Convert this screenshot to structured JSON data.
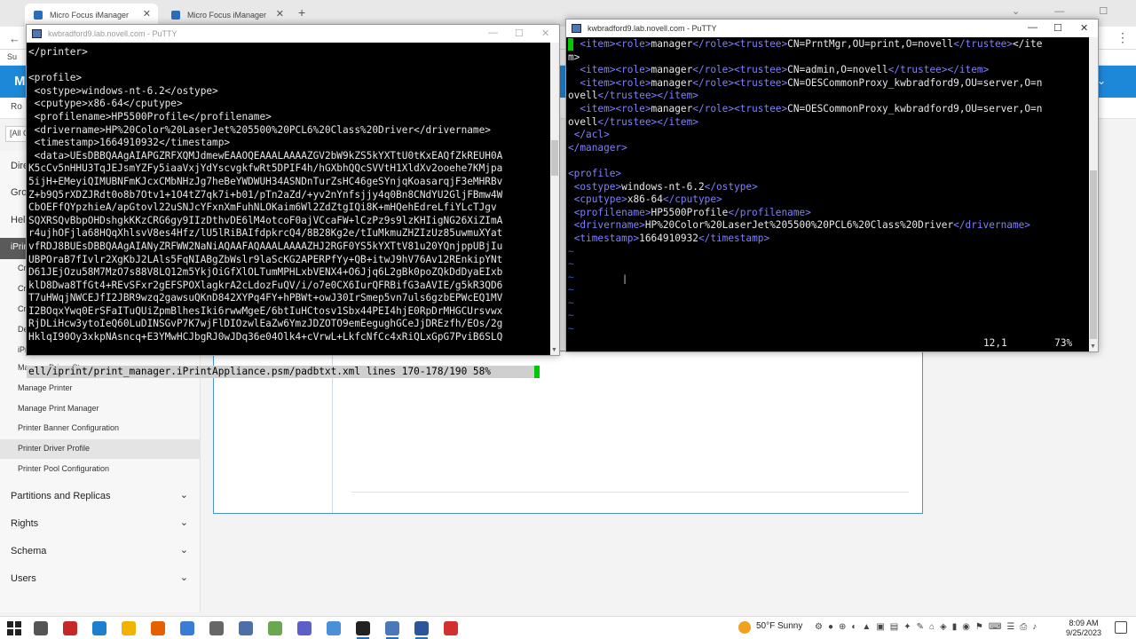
{
  "browser": {
    "tabs": [
      {
        "label": "Micro Focus iManager"
      },
      {
        "label": "Micro Focus iManager"
      }
    ],
    "new_tab_glyph": "+",
    "close_glyph": "✕",
    "back_glyph": "←",
    "menu_glyph": "⋮",
    "bookmark_label": "Su"
  },
  "imanager": {
    "header_logo": "M",
    "subnav_tab": "Ro",
    "filter_value": "[All C",
    "nav_fragments": [
      "Dire",
      "Grou",
      "Help"
    ],
    "iprint_label": "iPrin",
    "iprint_sub_fragments": [
      "Cr",
      "Cr",
      "Cr",
      "De",
      "iPr"
    ],
    "iprint_items": [
      {
        "label": "Manage Driver Store",
        "selected": false
      },
      {
        "label": "Manage Printer",
        "selected": false
      },
      {
        "label": "Manage Print Manager",
        "selected": false
      },
      {
        "label": "Printer Banner Configuration",
        "selected": false
      },
      {
        "label": "Printer Driver Profile",
        "selected": true
      },
      {
        "label": "Printer Pool Configuration",
        "selected": false
      }
    ],
    "sections": [
      {
        "label": "Partitions and Replicas"
      },
      {
        "label": "Rights"
      },
      {
        "label": "Schema"
      },
      {
        "label": "Users"
      }
    ]
  },
  "putty_left": {
    "title": "kwbradford9.lab.novell.com - PuTTY",
    "lines": [
      "</printer>",
      "",
      "<profile>",
      " <ostype>windows-nt-6.2</ostype>",
      " <cputype>x86-64</cputype>",
      " <profilename>HP5500Profile</profilename>",
      " <drivername>HP%20Color%20LaserJet%205500%20PCL6%20Class%20Driver</drivername>",
      " <timestamp>1664910932</timestamp>",
      " <data>UEsDBBQAAgAIAPGZRFXQMJdmewEAAOQEAAALAAAAZGV2bW9kZS5kYXTtU0tKxEAQfZkREUH0A",
      "K5cCv5nHHU3TqJEJsmYZFy5iaaVxjYdYscvgkfwRt5DPIF4h/hGXbhQQcSVVtH1XldXv2ooehe7KMjpa",
      "5ijH+EMeyiQIMUBNFmKJcxCMbNHzJg7heBeYWDWUH34ASNDnTurZsHC46geSYnjqKoasarqjF3eMHRBv",
      "Z+b9Q5rXDZJRdt0o8b7Otv1+1O4tZ7qk7i+b01/pTn2aZd/+yv2nYnfsjjy4q0Bn8CNdYU2GljFBmw4W",
      "CbOEFfQYpzhieA/apGtovl22uSNJcYFxnXmFuhNLOKaim6Wl2ZdZtgIQi8K+mHQehEdreLfiYLcTJgv",
      "SQXRSQvBbpOHDshgkKKzCRG6gy9IIzDthvDE6lM4otcoF0ajVCcaFW+lCzPz9s9lzKHIigNG26XiZImA",
      "r4ujhOFjla68HQqXhlsvV8es4Hfz/lU5lRiBAIfdpkrcQ4/8B28Kg2e/tIuMkmuZHZIzUz85uwmuXYat",
      "vfRDJ8BUEsDBBQAAgAIANyZRFWW2NaNiAQAAFAQAAALAAAAZHJ2RGF0YS5kYXTtV81u20YQnjppUBjIu",
      "UBPOraB7fIvlr2XgKbJ2LAls5FqNIABgZbWslr9laScKG2APERPfYy+QB+itwJ9hV76Av12REnkipYNt",
      "D61JEjOzu58M7MzO7s88V8LQ12m5YkjOiGfXlOLTumMPHLxbVENX4+O6Jjq6L2gBk0poZQkDdDyaEIxb",
      "klD8Dwa8TfGt4+REvSFxr2gEFSPOXlagkrA2cLdozFuQV/i/o7e0CX6IurQFRBifG3aAVIE/g5kR3QD6",
      "T7uHWqjNWCEJfI2JBR9wzq2gawsuQKnD842XYPq4FY+hPBWt+owJ30IrSmep5vn7uls6gzbEPWcEQ1MV",
      "I2BOqxYwq0ErSFaITuQUiZpmBlhesIki6rwwMgeE/6btIuHCtosv1Sbx44PEI4hjE0RpDrMHGCUrsvwx",
      "RjDLiHcw3ytoIeQ60LuDINSGvP7K7wjFlDIOzwlEaZw6YmzJDZOTO9emEegughGCeJjDREzfh/EOs/2g",
      "HklqI90Oy3xkpNAsncq+E3YMwHCJbgRJ0wJDq36e04Olk4+cVrwL+LkfcNfCc4xRiQLxGpG7PviB6SLQ"
    ],
    "status_line": "ell/iprint/print_manager.iPrintAppliance.psm/padbtxt.xml lines 170-178/190 58%"
  },
  "putty_right": {
    "title": "kwbradford9.lab.novell.com - PuTTY",
    "lines": [
      "  <item><role>manager</role><trustee>CN=PrntMgr,OU=print,O=novell</trustee></ite",
      "m>",
      "  <item><role>manager</role><trustee>CN=admin,O=novell</trustee></item>",
      "  <item><role>manager</role><trustee>CN=OESCommonProxy_kwbradford9,OU=server,O=n",
      "ovell</trustee></item>",
      "  <item><role>manager</role><trustee>CN=OESCommonProxy_kwbradford9,OU=server,O=n",
      "ovell</trustee></item>",
      " </acl>",
      "</manager>",
      "",
      "<profile>",
      " <ostype>windows-nt-6.2</ostype>",
      " <cputype>x86-64</cputype>",
      " <profilename>HP5500Profile</profilename>",
      " <drivername>HP%20Color%20LaserJet%205500%20PCL6%20Class%20Driver</drivername>",
      " <timestamp>1664910932</timestamp>",
      "~",
      "~",
      "~",
      "~",
      "~",
      "~",
      "~"
    ],
    "status_position": "12,1",
    "status_percent": "73%"
  },
  "taskbar": {
    "weather_temp": "50°F",
    "weather_desc": "Sunny",
    "clock_time": "8:09 AM",
    "clock_date": "9/25/2023",
    "apps": [
      {
        "name": "task-view",
        "color": "#555555"
      },
      {
        "name": "filezilla",
        "color": "#c62828"
      },
      {
        "name": "edge",
        "color": "#1e7fd0"
      },
      {
        "name": "file-explorer",
        "color": "#f0b400"
      },
      {
        "name": "firefox",
        "color": "#e66000"
      },
      {
        "name": "app-blue",
        "color": "#3a7bd5"
      },
      {
        "name": "calculator",
        "color": "#666666"
      },
      {
        "name": "app-tools",
        "color": "#4d6fa8"
      },
      {
        "name": "notepad",
        "color": "#6aa84f"
      },
      {
        "name": "teams",
        "color": "#5b5fc7"
      },
      {
        "name": "app-blue2",
        "color": "#4a90d9"
      },
      {
        "name": "terminal",
        "color": "#222222"
      },
      {
        "name": "putty",
        "color": "#4b78b8"
      },
      {
        "name": "app-word",
        "color": "#2b579a"
      },
      {
        "name": "app-red",
        "color": "#d32f2f"
      }
    ]
  },
  "colors": {
    "imanager_blue": "#1e88d8",
    "term_fg": "#e8e8e8",
    "term_tag": "#8080ff",
    "term_tilde": "#3c56c8",
    "cursor_green": "#00c800"
  }
}
